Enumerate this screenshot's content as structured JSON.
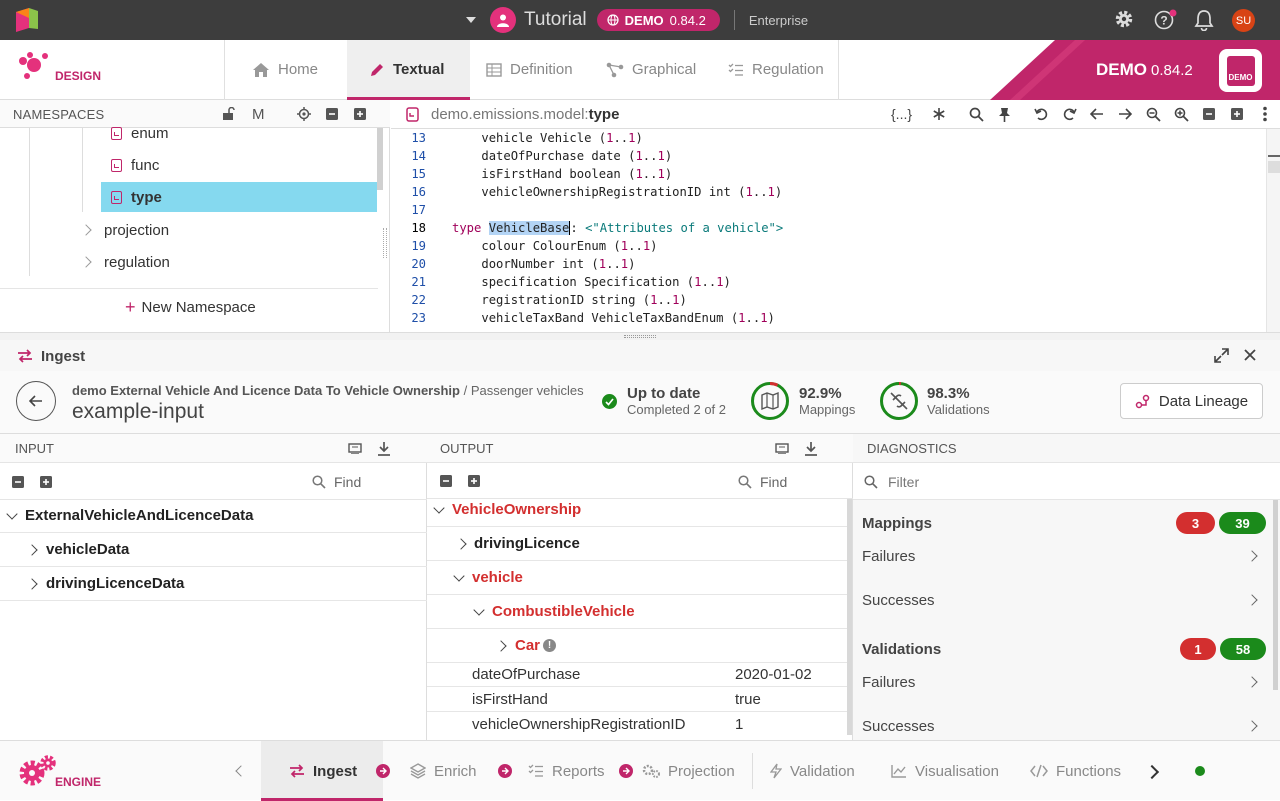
{
  "topbar": {
    "project": "Tutorial",
    "env_label": "DEMO",
    "env_version": "0.84.2",
    "edition": "Enterprise",
    "user_initials": "SU"
  },
  "design": {
    "logo_label": "DESIGN",
    "tabs": [
      {
        "label": "Home",
        "icon": "home-icon"
      },
      {
        "label": "Textual",
        "icon": "pencil-icon",
        "active": true
      },
      {
        "label": "Definition",
        "icon": "table-icon"
      },
      {
        "label": "Graphical",
        "icon": "graph-icon"
      },
      {
        "label": "Regulation",
        "icon": "checklist-icon"
      }
    ],
    "brand_name": "DEMO",
    "brand_version": "0.84.2",
    "brand_badge": "DEMO"
  },
  "namespaces": {
    "title": "NAMESPACES",
    "m_label": "M",
    "items": [
      {
        "label": "enum",
        "type": "file"
      },
      {
        "label": "func",
        "type": "file"
      },
      {
        "label": "type",
        "type": "file",
        "selected": true
      },
      {
        "label": "projection",
        "type": "folder"
      },
      {
        "label": "regulation",
        "type": "folder"
      }
    ],
    "new_label": "New Namespace"
  },
  "editor": {
    "path_prefix": "demo.emissions.model:",
    "path_suffix": "type",
    "braces_label": "{...}",
    "lines": [
      {
        "n": "13",
        "indent": "    ",
        "parts": [
          [
            "vehicle Vehicle (",
            ""
          ],
          [
            "1",
            "nm"
          ],
          [
            "..",
            ""
          ],
          [
            "1",
            "nm"
          ],
          [
            ")",
            ""
          ]
        ]
      },
      {
        "n": "14",
        "indent": "    ",
        "parts": [
          [
            "dateOfPurchase date (",
            ""
          ],
          [
            "1",
            "nm"
          ],
          [
            "..",
            ""
          ],
          [
            "1",
            "nm"
          ],
          [
            ")",
            ""
          ]
        ]
      },
      {
        "n": "15",
        "indent": "    ",
        "parts": [
          [
            "isFirstHand boolean (",
            ""
          ],
          [
            "1",
            "nm"
          ],
          [
            "..",
            ""
          ],
          [
            "1",
            "nm"
          ],
          [
            ")",
            ""
          ]
        ]
      },
      {
        "n": "16",
        "indent": "    ",
        "parts": [
          [
            "vehicleOwnershipRegistrationID int (",
            ""
          ],
          [
            "1",
            "nm"
          ],
          [
            "..",
            ""
          ],
          [
            "1",
            "nm"
          ],
          [
            ")",
            ""
          ]
        ]
      },
      {
        "n": "17",
        "indent": "",
        "parts": []
      },
      {
        "n": "18",
        "indent": "",
        "parts": [
          [
            "type ",
            "kw"
          ],
          [
            "VehicleBase",
            "hl"
          ],
          [
            ": ",
            ""
          ],
          [
            "<\"Attributes of a vehicle\">",
            "st"
          ]
        ]
      },
      {
        "n": "19",
        "indent": "    ",
        "parts": [
          [
            "colour ColourEnum (",
            ""
          ],
          [
            "1",
            "nm"
          ],
          [
            "..",
            ""
          ],
          [
            "1",
            "nm"
          ],
          [
            ")",
            ""
          ]
        ]
      },
      {
        "n": "20",
        "indent": "    ",
        "parts": [
          [
            "doorNumber int (",
            ""
          ],
          [
            "1",
            "nm"
          ],
          [
            "..",
            ""
          ],
          [
            "1",
            "nm"
          ],
          [
            ")",
            ""
          ]
        ]
      },
      {
        "n": "21",
        "indent": "    ",
        "parts": [
          [
            "specification Specification (",
            ""
          ],
          [
            "1",
            "nm"
          ],
          [
            "..",
            ""
          ],
          [
            "1",
            "nm"
          ],
          [
            ")",
            ""
          ]
        ]
      },
      {
        "n": "22",
        "indent": "    ",
        "parts": [
          [
            "registrationID string (",
            ""
          ],
          [
            "1",
            "nm"
          ],
          [
            "..",
            ""
          ],
          [
            "1",
            "nm"
          ],
          [
            ")",
            ""
          ]
        ]
      },
      {
        "n": "23",
        "indent": "    ",
        "parts": [
          [
            "vehicleTaxBand VehicleTaxBandEnum (",
            ""
          ],
          [
            "1",
            "nm"
          ],
          [
            "..",
            ""
          ],
          [
            "1",
            "nm"
          ],
          [
            ")",
            ""
          ]
        ]
      }
    ]
  },
  "ingest": {
    "title": "Ingest",
    "breadcrumb_main": "demo External Vehicle And Licence Data To Vehicle Ownership",
    "breadcrumb_sep": "/",
    "breadcrumb_sub": "Passenger vehicles",
    "name": "example-input",
    "status_title": "Up to date",
    "status_sub": "Completed 2 of 2",
    "mappings_pct": "92.9%",
    "mappings_label": "Mappings",
    "mappings_fraction": 0.929,
    "validations_pct": "98.3%",
    "validations_label": "Validations",
    "validations_fraction": 0.983,
    "lineage_label": "Data Lineage"
  },
  "input": {
    "title": "INPUT",
    "find_placeholder": "Find",
    "root": "ExternalVehicleAndLicenceData",
    "children": [
      "vehicleData",
      "drivingLicenceData"
    ]
  },
  "output": {
    "title": "OUTPUT",
    "find_placeholder": "Find",
    "root": "VehicleOwnership",
    "driving": "drivingLicence",
    "vehicle": "vehicle",
    "combustible": "CombustibleVehicle",
    "car": "Car",
    "fields": [
      {
        "name": "dateOfPurchase",
        "value": "2020-01-02"
      },
      {
        "name": "isFirstHand",
        "value": "true"
      },
      {
        "name": "vehicleOwnershipRegistrationID",
        "value": "1"
      }
    ]
  },
  "diagnostics": {
    "title": "DIAGNOSTICS",
    "filter_placeholder": "Filter",
    "mappings": {
      "title": "Mappings",
      "fail_count": "3",
      "success_count": "39"
    },
    "validations": {
      "title": "Validations",
      "fail_count": "1",
      "success_count": "58"
    },
    "failures_label": "Failures",
    "successes_label": "Successes"
  },
  "bottom": {
    "logo_label": "ENGINE",
    "tabs": [
      "Ingest",
      "Enrich",
      "Reports",
      "Projection",
      "Validation",
      "Visualisation",
      "Functions"
    ]
  },
  "colors": {
    "accent": "#c0266a",
    "success": "#1b8a1b",
    "error": "#d32f2f",
    "topbar": "#3d3d3d"
  }
}
